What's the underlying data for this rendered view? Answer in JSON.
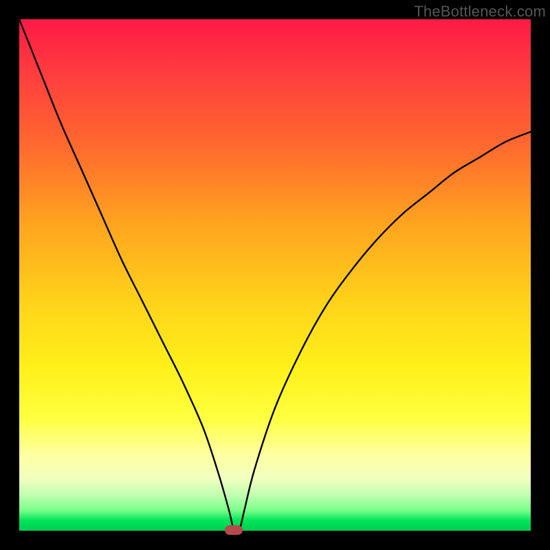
{
  "watermark": "TheBottleneck.com",
  "colors": {
    "background": "#000000",
    "gradient_top": "#ff1a46",
    "gradient_bottom": "#00cc50",
    "curve": "#000000",
    "marker": "#b74a4a",
    "watermark_text": "#555555"
  },
  "chart_data": {
    "type": "line",
    "title": "",
    "xlabel": "",
    "ylabel": "",
    "xlim": [
      0,
      100
    ],
    "ylim": [
      0,
      100
    ],
    "grid": false,
    "legend": false,
    "annotations": [
      {
        "name": "optimum-marker",
        "x": 42,
        "y": 0,
        "shape": "pill",
        "color": "#b74a4a"
      }
    ],
    "series": [
      {
        "name": "bottleneck-curve",
        "x": [
          0,
          4,
          8,
          12,
          16,
          20,
          24,
          28,
          32,
          36,
          39,
          41,
          42,
          43,
          44,
          46,
          50,
          55,
          60,
          65,
          70,
          75,
          80,
          85,
          90,
          95,
          100
        ],
        "values": [
          100,
          90,
          80,
          71,
          62,
          53,
          45,
          37,
          29,
          20,
          11,
          4,
          0,
          0,
          4,
          12,
          24,
          35,
          44,
          51,
          57,
          62,
          66,
          70,
          73,
          76,
          78
        ]
      }
    ]
  }
}
